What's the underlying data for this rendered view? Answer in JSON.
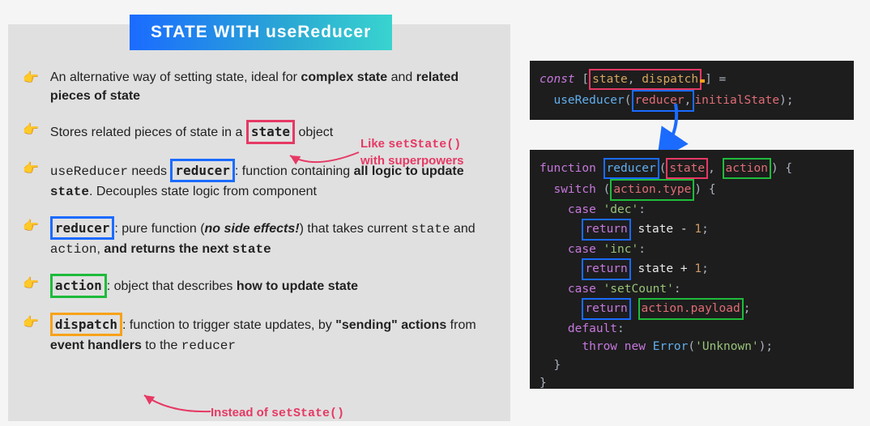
{
  "title": "STATE WITH useReducer",
  "bullets": [
    {
      "t1": "An alternative way of setting state, ideal for ",
      "b1": "complex state",
      "t2": " and ",
      "b2": "related pieces of state"
    },
    {
      "t1": "Stores related pieces of state in a ",
      "box": "state",
      "box_color": "red",
      "t2": " object"
    },
    {
      "m1": "useReducer",
      "t1": " needs ",
      "box": "reducer",
      "box_color": "blue",
      "t2": ": function containing ",
      "b1": "all logic to update ",
      "m2": "state",
      "t3": ". Decouples state logic from component"
    },
    {
      "box": "reducer",
      "box_color": "blue",
      "t1": ": pure function (",
      "i1": "no side effects!",
      "t2": ") that takes current ",
      "m1": "state",
      "t3": " and ",
      "m2": "action",
      "t4": ", ",
      "b1": "and returns the next ",
      "m3": "state"
    },
    {
      "box": "action",
      "box_color": "green",
      "t1": ": object that describes ",
      "b1": "how to update state"
    },
    {
      "box": "dispatch",
      "box_color": "orange",
      "t1": ": function to trigger state updates, by ",
      "b1": "\"sending\" actions",
      "t2": " from ",
      "b2": "event handlers",
      "t3": " to the ",
      "m1": "reducer"
    }
  ],
  "annot1_l1": "Like ",
  "annot1_m1": "setState()",
  "annot1_l2": "with superpowers",
  "annot2_t1": "Instead of ",
  "annot2_m1": "setState()",
  "code1": {
    "const": "const",
    "state": "state",
    "dispatch": "dispatch",
    "useReducer": "useReducer",
    "reducer": "reducer",
    "initialState": "initialState"
  },
  "code2": {
    "function": "function",
    "reducer": "reducer",
    "state": "state",
    "action": "action",
    "switch": "switch",
    "action_type": "action.type",
    "case": "case",
    "dec": "'dec'",
    "inc": "'inc'",
    "setCount": "'setCount'",
    "return": "return",
    "state_m1": "state - 1",
    "state_p1": "state + 1",
    "action_payload": "action.payload",
    "default": "default",
    "throw": "throw",
    "new": "new",
    "Error": "Error",
    "unknown": "'Unknown'"
  }
}
